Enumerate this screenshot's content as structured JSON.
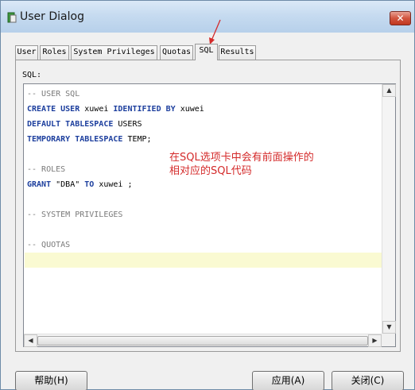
{
  "window": {
    "title": "User Dialog",
    "close_glyph": "✕"
  },
  "tabs": [
    {
      "label": "User"
    },
    {
      "label": "Roles"
    },
    {
      "label": "System Privileges"
    },
    {
      "label": "Quotas"
    },
    {
      "label": "SQL",
      "active": true
    },
    {
      "label": "Results"
    }
  ],
  "sql_panel": {
    "label": "SQL:",
    "lines": [
      {
        "parts": [
          {
            "t": "-- USER SQL",
            "c": "cm"
          }
        ]
      },
      {
        "parts": [
          {
            "t": "CREATE USER",
            "c": "kw"
          },
          {
            "t": " xuwei "
          },
          {
            "t": "IDENTIFIED BY",
            "c": "kw"
          },
          {
            "t": " xuwei"
          }
        ]
      },
      {
        "parts": [
          {
            "t": "DEFAULT TABLESPACE",
            "c": "kw"
          },
          {
            "t": " USERS"
          }
        ]
      },
      {
        "parts": [
          {
            "t": "TEMPORARY TABLESPACE",
            "c": "kw"
          },
          {
            "t": " TEMP;"
          }
        ]
      },
      {
        "parts": []
      },
      {
        "parts": [
          {
            "t": "-- ROLES",
            "c": "cm"
          }
        ]
      },
      {
        "parts": [
          {
            "t": "GRANT",
            "c": "kw"
          },
          {
            "t": " \"DBA\" "
          },
          {
            "t": "TO",
            "c": "kw"
          },
          {
            "t": " xuwei ;"
          }
        ]
      },
      {
        "parts": []
      },
      {
        "parts": [
          {
            "t": "-- SYSTEM PRIVILEGES",
            "c": "cm"
          }
        ]
      },
      {
        "parts": []
      },
      {
        "parts": [
          {
            "t": "-- QUOTAS",
            "c": "cm"
          }
        ]
      }
    ]
  },
  "annotation": {
    "line1": "在SQL选项卡中会有前面操作的",
    "line2": "相对应的SQL代码"
  },
  "buttons": {
    "help": "帮助(H)",
    "apply": "应用(A)",
    "close": "关闭(C)"
  },
  "colors": {
    "keyword": "#1d3f9e",
    "comment": "#7a7a7a",
    "annotation": "#d42a2a",
    "current_line": "#fafad2"
  }
}
